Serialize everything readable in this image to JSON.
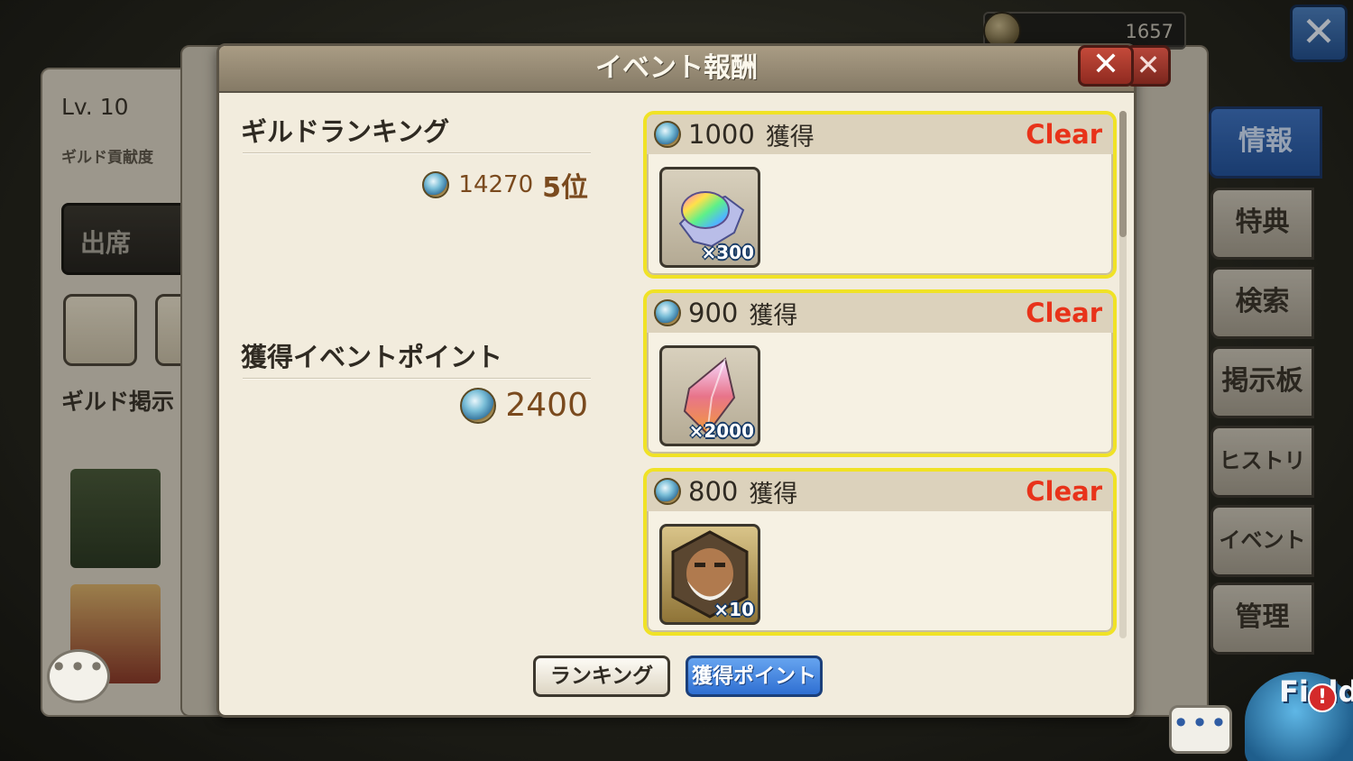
{
  "background": {
    "level_label": "Lv.",
    "level_value": "10",
    "contribution_label": "ギルド貢献度",
    "attendance_button": "出席",
    "board_label": "ギルド掲示",
    "currency_value": "1657"
  },
  "side_tabs": [
    {
      "label": "情報",
      "active": true
    },
    {
      "label": "特典",
      "active": false
    },
    {
      "label": "検索",
      "active": false
    },
    {
      "label": "掲示板",
      "active": false
    },
    {
      "label": "ヒストリー",
      "active": false
    },
    {
      "label": "イベント",
      "active": false
    },
    {
      "label": "管理",
      "active": false
    }
  ],
  "field": {
    "label": "Field",
    "alert": "!"
  },
  "chat": {
    "dots": "•••"
  },
  "dialog": {
    "title": "イベント報酬",
    "close_symbol": "✕",
    "guild_ranking": {
      "title": "ギルドランキング",
      "points": "14270",
      "position": "5位"
    },
    "event_points": {
      "title": "獲得イベントポイント",
      "value": "2400"
    },
    "rewards": [
      {
        "amount": "1000",
        "earn_label": "獲得",
        "status": "Clear",
        "item": "rainbow-crystal-icon",
        "qty": "×300"
      },
      {
        "amount": "900",
        "earn_label": "獲得",
        "status": "Clear",
        "item": "power-crystal-icon",
        "qty": "×2000"
      },
      {
        "amount": "800",
        "earn_label": "獲得",
        "status": "Clear",
        "item": "character-portrait-icon",
        "qty": "×10"
      }
    ],
    "buttons": {
      "ranking": "ランキング",
      "points": "獲得ポイント"
    }
  },
  "colors": {
    "clear": "#e8331a",
    "highlight_border": "#f0e226",
    "active_tab": "#2f6fd2"
  }
}
